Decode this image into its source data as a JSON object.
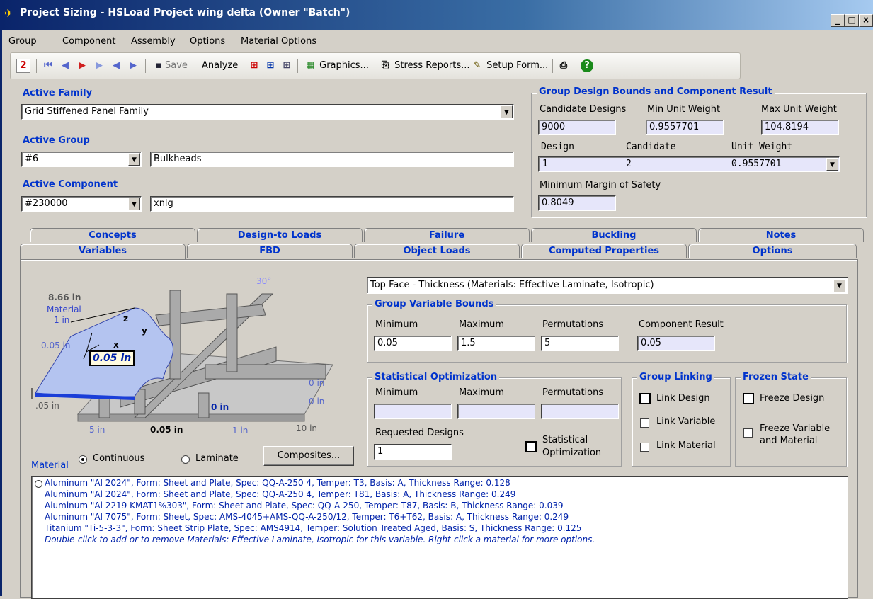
{
  "window": {
    "title": "Project Sizing - HSLoad Project wing delta (Owner \"Batch\")",
    "controls": [
      "_",
      "□",
      "×"
    ]
  },
  "menu": [
    "Group",
    "Component",
    "Assembly",
    "Options",
    "Material Options"
  ],
  "toolbar": {
    "save": "Save",
    "analyze": "Analyze",
    "graphics": "Graphics...",
    "stress_reports": "Stress Reports...",
    "setup_form": "Setup Form..."
  },
  "active_family": {
    "label": "Active Family",
    "value": "Grid Stiffened Panel Family"
  },
  "active_group": {
    "label": "Active Group",
    "id": "#6",
    "name": "Bulkheads"
  },
  "active_component": {
    "label": "Active Component",
    "id": "#230000",
    "name": "xnlg"
  },
  "bounds": {
    "title": "Group Design Bounds and Component Result",
    "candidate_designs_label": "Candidate Designs",
    "min_unit_weight_label": "Min Unit Weight",
    "max_unit_weight_label": "Max Unit Weight",
    "candidate_designs": "9000",
    "min_unit_weight": "0.9557701",
    "max_unit_weight": "104.8194",
    "design_label": "Design",
    "candidate_label": "Candidate",
    "unit_weight_label": "Unit Weight",
    "design": "1",
    "candidate": "2",
    "unit_weight": "0.9557701",
    "min_margin_label": "Minimum Margin of Safety",
    "min_margin": "0.8049"
  },
  "tabs_back": [
    "Concepts",
    "Design-to Loads",
    "Failure",
    "Buckling",
    "Notes"
  ],
  "tabs_front": [
    "Variables",
    "FBD",
    "Object Loads",
    "Computed Properties",
    "Options"
  ],
  "diagram": {
    "angle": "30°",
    "t866": "8.66 in",
    "material_lbl": "Material",
    "one_in": "1 in",
    "x": "x",
    "y": "y",
    "z": "z",
    "left_thk": "0.05 in",
    "highlight": "0.05 in",
    "zero1": "0 in",
    "zero2": "0 in",
    "side": ".05 in",
    "zero3": "0 in",
    "five": "5 in",
    "bottom_thk": "0.05 in",
    "one_b": "1 in",
    "ten": "10 in"
  },
  "variable_select": "Top Face - Thickness (Materials: Effective Laminate, Isotropic)",
  "group_variable_bounds": {
    "title": "Group Variable Bounds",
    "minimum_label": "Minimum",
    "maximum_label": "Maximum",
    "permutations_label": "Permutations",
    "result_label": "Component Result",
    "minimum": "0.05",
    "maximum": "1.5",
    "permutations": "5",
    "result": "0.05"
  },
  "statistical": {
    "title": "Statistical Optimization",
    "minimum_label": "Minimum",
    "maximum_label": "Maximum",
    "permutations_label": "Permutations",
    "requested_label": "Requested Designs",
    "requested": "1",
    "checkbox_label_1": "Statistical",
    "checkbox_label_2": "Optimization"
  },
  "group_linking": {
    "title": "Group Linking",
    "link_design": "Link Design",
    "link_variable": "Link Variable",
    "link_material": "Link Material"
  },
  "frozen": {
    "title": "Frozen State",
    "freeze_design": "Freeze Design",
    "freeze_var_1": "Freeze Variable",
    "freeze_var_2": "and Material"
  },
  "material": {
    "label": "Material",
    "continuous": "Continuous",
    "laminate": "Laminate",
    "composites_btn": "Composites...",
    "list": [
      "Aluminum \"Al 2024\", Form: Sheet and Plate, Spec: QQ-A-250 4, Temper: T3, Basis: A, Thickness Range: 0.128",
      "Aluminum \"Al 2024\", Form: Sheet and Plate, Spec: QQ-A-250 4, Temper: T81, Basis: A, Thickness Range: 0.249",
      "Aluminum \"Al 2219 KMAT1%303\", Form: Sheet and Plate, Spec: QQ-A-250, Temper: T87, Basis: B, Thickness Range: 0.039",
      "Aluminum \"Al 7075\", Form: Sheet, Spec: AMS-4045+AMS-QQ-A-250/12, Temper: T6+T62, Basis: A, Thickness Range: 0.249",
      "Titanium \"Ti-5-3-3\", Form: Sheet Strip Plate, Spec: AMS4914, Temper: Solution Treated Aged, Basis: S, Thickness Range: 0.125"
    ],
    "note": "Double-click to add or to remove Materials: Effective Laminate, Isotropic for this variable.  Right-click a material for more options."
  },
  "colors": {
    "titlebar": "#0a246a",
    "label_blue": "#0033cc",
    "readonly_field": "#e6e6fa",
    "face_blue": "#b4c4f0"
  }
}
